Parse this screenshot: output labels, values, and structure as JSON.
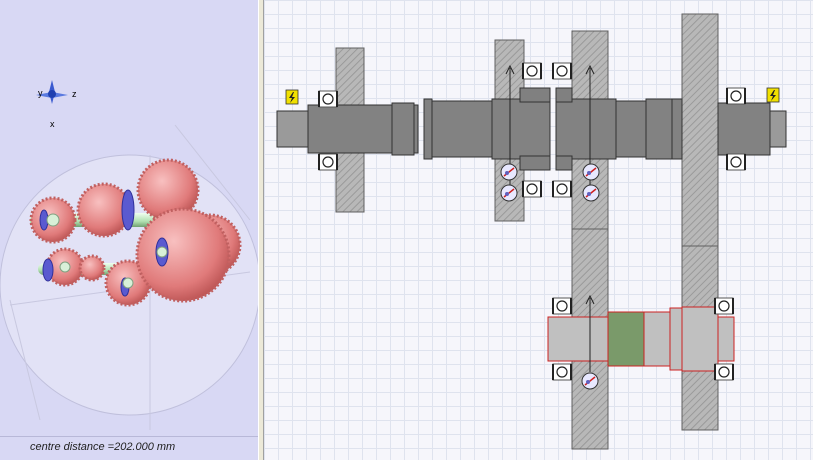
{
  "status": {
    "text": "centre distance =202.000 mm"
  },
  "axis_triad": {
    "labels": [
      "y",
      "z",
      "x"
    ]
  },
  "colors": {
    "background_3d": "#d8d8f4",
    "gear_3d": "#e88a8a",
    "shaft_3d": "#b8e8b8",
    "bearing_3d": "#5a5ad0",
    "shaft_section": "#808080",
    "gear_section": "#b4b4b4",
    "selected_shaft": "#cc2222",
    "highlight_segment": "#7a9a6a",
    "warning_icon": "#f0e000"
  },
  "icons": [
    "axis-triad-icon",
    "lightning-warning-icon",
    "load-indicator-icon",
    "rolling-bearing-icon"
  ]
}
